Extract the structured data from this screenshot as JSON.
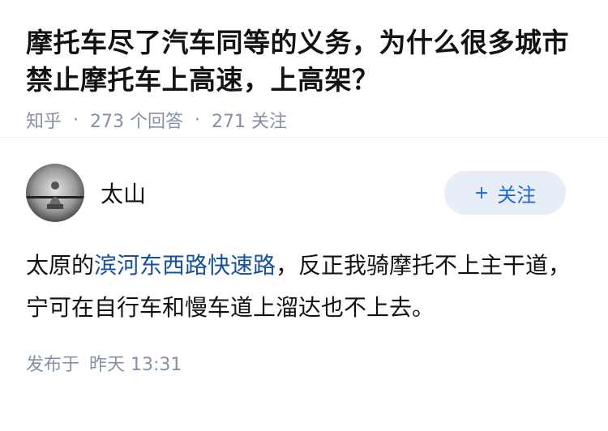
{
  "question": {
    "title": "摩托车尽了汽车同等的义务，为什么很多城市禁止摩托车上高速，上高架？",
    "source": "知乎",
    "separator": "·",
    "answers_count": "273 个回答",
    "followers_count": "271 关注"
  },
  "answer": {
    "author": {
      "name": "太山",
      "avatar_icon": "avatar-icon"
    },
    "follow_button": {
      "plus": "+",
      "label": "关注"
    },
    "content": {
      "prefix": "太原的",
      "link_text": "滨河东西路快速路",
      "suffix": "，反正我骑摩托不上主干道，宁可在自行车和慢车道上溜达也不上去。"
    },
    "published_label": "发布于",
    "published_time": "昨天 13:31"
  },
  "colors": {
    "link": "#175199",
    "meta_gray": "#8590a6",
    "follow_bg": "#e8eef7",
    "follow_text": "#1a66d6"
  }
}
